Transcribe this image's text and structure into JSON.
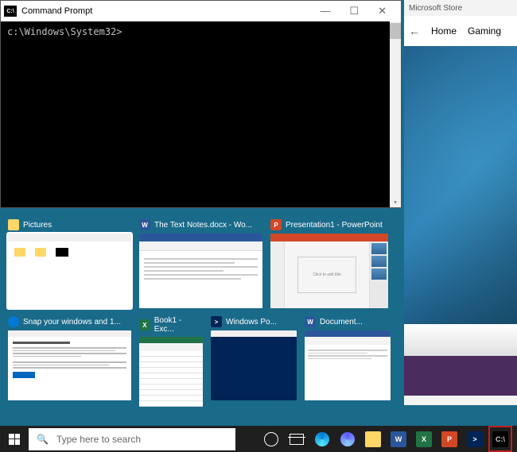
{
  "cmd": {
    "title": "Command Prompt",
    "icon_label": "C:\\",
    "prompt": "c:\\Windows\\System32>"
  },
  "store": {
    "title": "Microsoft Store",
    "nav": {
      "home": "Home",
      "gaming": "Gaming"
    }
  },
  "snap_tiles": [
    {
      "label": "Pictures",
      "app_letter": "",
      "app_color": "#ffd766"
    },
    {
      "label": "The Text Notes.docx - Wo...",
      "app_letter": "W",
      "app_color": "#2b579a"
    },
    {
      "label": "Presentation1 - PowerPoint",
      "app_letter": "P",
      "app_color": "#d24726",
      "slide_text": "Click to add title"
    },
    {
      "label": "Snap your windows and 1...",
      "app_letter": "",
      "app_color": "#0078d4"
    },
    {
      "label": "Book1 - Exc...",
      "app_letter": "X",
      "app_color": "#217346"
    },
    {
      "label": "Windows Po...",
      "app_letter": ">",
      "app_color": "#012456"
    },
    {
      "label": "Document...",
      "app_letter": "W",
      "app_color": "#2b579a"
    }
  ],
  "taskbar": {
    "search_placeholder": "Type here to search"
  }
}
